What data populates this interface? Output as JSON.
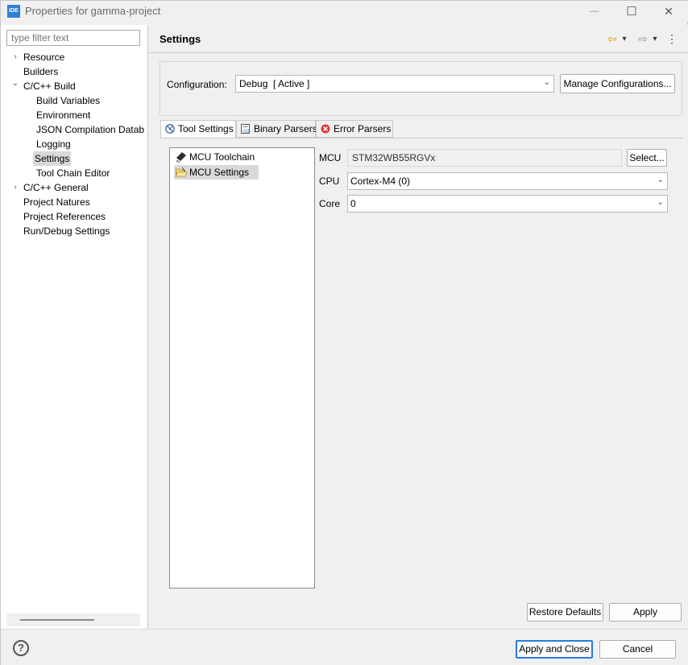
{
  "window": {
    "app_icon_text": "IDE",
    "title": "Properties for gamma-project",
    "minimize_glyph": "—",
    "maximize_glyph": "☐",
    "close_glyph": "✕"
  },
  "filter": {
    "placeholder": "type filter text"
  },
  "tree": {
    "items": [
      {
        "label": "Resource",
        "twisty": "›"
      },
      {
        "label": "Builders"
      },
      {
        "label": "C/C++ Build",
        "twisty": "⌄"
      },
      {
        "label": "Build Variables"
      },
      {
        "label": "Environment"
      },
      {
        "label": "JSON Compilation Datab"
      },
      {
        "label": "Logging"
      },
      {
        "label": "Settings",
        "selected": true
      },
      {
        "label": "Tool Chain Editor"
      },
      {
        "label": "C/C++ General",
        "twisty": "›"
      },
      {
        "label": "Project Natures"
      },
      {
        "label": "Project References"
      },
      {
        "label": "Run/Debug Settings"
      }
    ]
  },
  "page": {
    "title": "Settings",
    "back_glyph": "⇦",
    "forward_glyph": "⇨",
    "dropdown_glyph": "▾",
    "menu_glyph": "⋮"
  },
  "configuration": {
    "label": "Configuration:",
    "value": "Debug  [ Active ]",
    "manage_label": "Manage Configurations..."
  },
  "tabs": [
    {
      "label": "Tool Settings",
      "active": true,
      "icon": "tool-settings-icon"
    },
    {
      "label": "Binary Parsers",
      "icon": "binary-parsers-icon"
    },
    {
      "label": "Error Parsers",
      "icon": "error-parsers-icon"
    }
  ],
  "tool_list": [
    {
      "label": "MCU Toolchain",
      "icon": "chip-icon"
    },
    {
      "label": "MCU Settings",
      "icon": "folder-open-icon",
      "selected": true
    }
  ],
  "fields": {
    "mcu_label": "MCU",
    "mcu_value": "STM32WB55RGVx",
    "select_label": "Select...",
    "cpu_label": "CPU",
    "cpu_value": "Cortex-M4 (0)",
    "core_label": "Core",
    "core_value": "0",
    "combo_chevron": "⌄"
  },
  "buttons": {
    "restore_defaults": "Restore Defaults",
    "apply": "Apply",
    "apply_and_close": "Apply and Close",
    "cancel": "Cancel",
    "help_glyph": "?"
  },
  "colors": {
    "accent": "#2a7ae2",
    "selection": "#d9d9d9",
    "error_icon": "#e0393e",
    "nav_arrow": "#e0a020"
  }
}
